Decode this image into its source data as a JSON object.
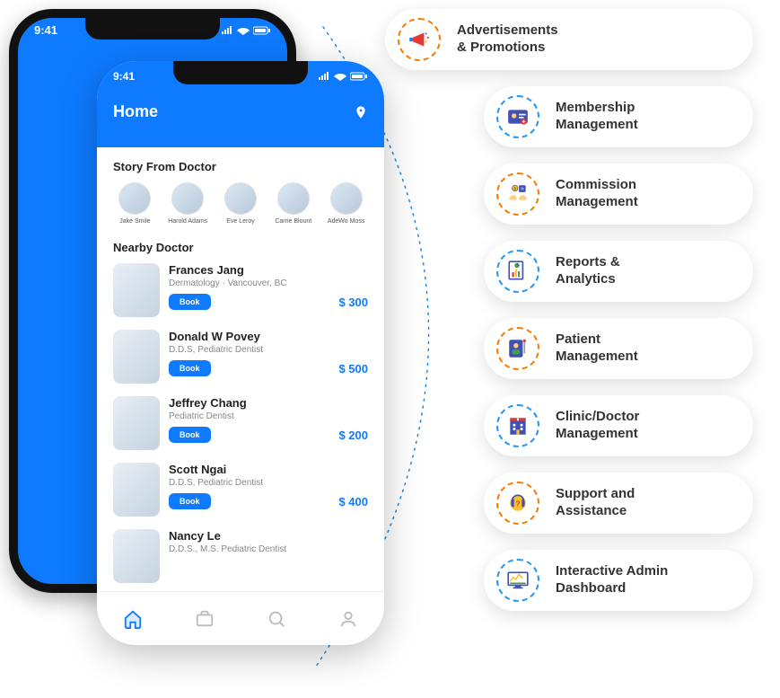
{
  "status_time": "9:41",
  "app": {
    "home_title": "Home",
    "story_section": "Story From Doctor",
    "nearby_section": "Nearby Doctor",
    "book_label": "Book",
    "stories": [
      {
        "name": "Jake Smile"
      },
      {
        "name": "Harold Adams"
      },
      {
        "name": "Eve Leroy"
      },
      {
        "name": "Carrie Blount"
      },
      {
        "name": "AdeWo Moss"
      }
    ],
    "doctors": [
      {
        "name": "Frances Jang",
        "spec": "Dermatology · Vancouver, BC",
        "price": "$ 300"
      },
      {
        "name": "Donald W Povey",
        "spec": "D.D.S, Pediatric Dentist",
        "price": "$ 500"
      },
      {
        "name": "Jeffrey Chang",
        "spec": "Pediatric Dentist",
        "price": "$ 200"
      },
      {
        "name": "Scott Ngai",
        "spec": "D.D.S, Pediatric Dentist",
        "price": "$ 400"
      },
      {
        "name": "Nancy Le",
        "spec": "D.D.S., M.S. Pediatric Dentist",
        "price": ""
      }
    ]
  },
  "features": [
    {
      "label": "Advertisements\n& Promotions",
      "icon": "megaphone",
      "color": "orange"
    },
    {
      "label": "Membership\nManagement",
      "icon": "id-card",
      "color": "blue"
    },
    {
      "label": "Commission\nManagement",
      "icon": "commission",
      "color": "orange"
    },
    {
      "label": "Reports &\nAnalytics",
      "icon": "report",
      "color": "blue"
    },
    {
      "label": "Patient\nManagement",
      "icon": "patient",
      "color": "orange"
    },
    {
      "label": "Clinic/Doctor\nManagement",
      "icon": "clinic",
      "color": "blue"
    },
    {
      "label": "Support and\nAssistance",
      "icon": "support",
      "color": "orange"
    },
    {
      "label": "Interactive Admin\nDashboard",
      "icon": "dashboard",
      "color": "blue"
    }
  ]
}
